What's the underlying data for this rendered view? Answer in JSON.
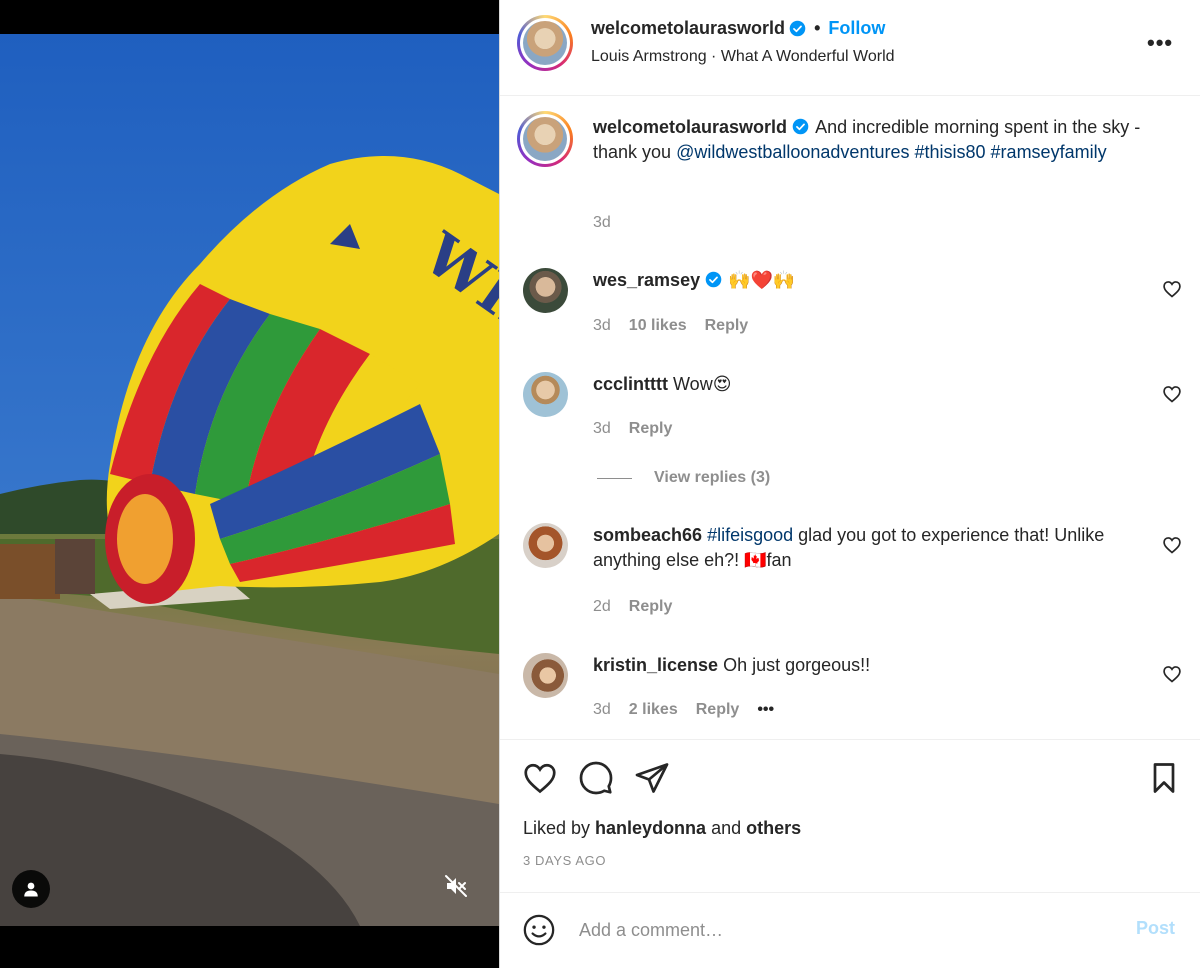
{
  "header": {
    "username": "welcometolaurasworld",
    "separator": "•",
    "follow_label": "Follow",
    "audio": "Louis Armstrong · What A Wonderful World",
    "more_label": "•••"
  },
  "caption": {
    "username": "welcometolaurasworld",
    "text_before": "And incredible morning spent in the sky - thank you ",
    "mention": "@wildwestballoonadventures",
    "hashtag1": "#thisis80",
    "hashtag2": "#ramseyfamily",
    "time": "3d"
  },
  "comments": [
    {
      "username": "wes_ramsey",
      "text": "🙌❤️🙌",
      "time": "3d",
      "likes": "10 likes",
      "reply": "Reply"
    },
    {
      "username": "ccclintttt",
      "text": "Wow😍",
      "time": "3d",
      "reply": "Reply",
      "view_replies": "View replies (3)"
    },
    {
      "username": "sombeach66",
      "hashtag": "#lifeisgood",
      "text": " glad you got to experience that! Unlike anything else eh?! 🇨🇦fan",
      "time": "2d",
      "reply": "Reply"
    },
    {
      "username": "kristin_license",
      "text": "Oh just gorgeous!!",
      "time": "3d",
      "likes": "2 likes",
      "reply": "Reply",
      "more": "•••"
    }
  ],
  "likes": {
    "prefix": "Liked by ",
    "user": "hanleydonna",
    "mid": " and ",
    "others": "others"
  },
  "date": "3 DAYS AGO",
  "add_comment": {
    "placeholder": "Add a comment…",
    "post_label": "Post"
  },
  "colors": {
    "accent": "#0095f6",
    "link": "#00376b",
    "muted": "#8e8e8e",
    "post_disabled": "#b2dffc"
  }
}
